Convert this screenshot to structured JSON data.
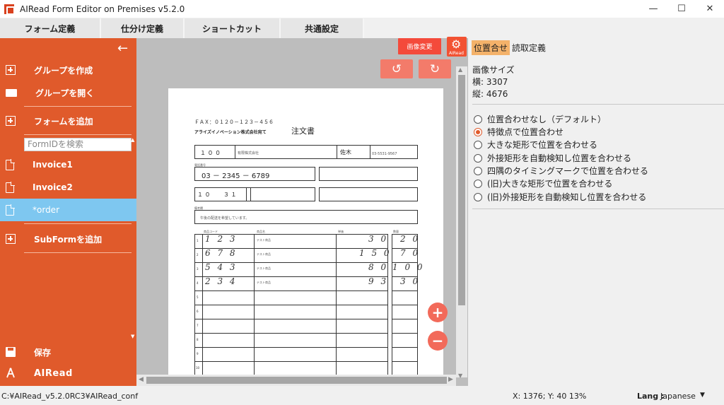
{
  "window": {
    "title": "AIRead Form Editor on Premises v5.2.0",
    "controls": {
      "minimize": "—",
      "maximize": "☐",
      "close": "✕"
    }
  },
  "menu": {
    "items": [
      "フォーム定義",
      "仕分け定義",
      "ショートカット",
      "共通設定"
    ]
  },
  "sidebar": {
    "back": "←",
    "create_group": "グループを作成",
    "open_group": "グループを開く",
    "add_form": "フォームを追加",
    "search_placeholder": "FormIDを検索",
    "forms": [
      "Invoice1",
      "Invoice2",
      "*order"
    ],
    "add_subform": "SubFormを追加",
    "save": "保存",
    "brand": "AIRead"
  },
  "canvas": {
    "image_change": "画像変更",
    "gear_label": "AIRead",
    "rotate_left": "↺",
    "rotate_right": "↻",
    "zoom_in": "+",
    "zoom_out": "−",
    "document": {
      "fax": "ＦＡＸ：０１２０－１２３－４５６",
      "to": "アライズイノベーション株式会社宛て",
      "title": "注文書",
      "row1_code": "１ ０ ０",
      "row1_company": "有限株式会社",
      "row1_name": "佐木",
      "row1_tel": "03-5531-9567",
      "phone_label": "電話番号",
      "phone": "03 － 2345 － 6789",
      "date_m": "１ ０",
      "date_d": "３ １",
      "note_label": "備考欄",
      "note_text": "午後の配送を希望しています。",
      "col_code": "商品コード",
      "col_name": "商品名",
      "col_price": "単価",
      "col_qty": "数量",
      "rows": [
        {
          "no": "1",
          "code": "1 2 3",
          "name": "テスト商品",
          "price": "3 0",
          "qty": "2 0"
        },
        {
          "no": "2",
          "code": "6 7 8",
          "name": "テスト商品",
          "price": "1 5 0",
          "qty": "7 0"
        },
        {
          "no": "3",
          "code": "5 4 3",
          "name": "テスト商品",
          "price": "8 0",
          "qty": "1 0 0"
        },
        {
          "no": "4",
          "code": "2 3 4",
          "name": "テスト商品",
          "price": "9 3",
          "qty": "3 0"
        }
      ],
      "empty_rows": [
        "5",
        "6",
        "7",
        "8",
        "9",
        "10"
      ]
    }
  },
  "right_panel": {
    "tabs": [
      "位置合せ",
      "読取定義"
    ],
    "image_size_label": "画像サイズ",
    "width_text": "横: 3307",
    "height_text": "縦: 4676",
    "options": [
      "位置合わせなし（デフォルト）",
      "特徴点で位置合わせ",
      "大きな矩形で位置を合わせる",
      "外接矩形を自動検知し位置を合わせる",
      "四隅のタイミングマークで位置を合わせる",
      "(旧)大きな矩形で位置を合わせる",
      "(旧)外接矩形を自動検知し位置を合わせる"
    ],
    "selected_option": 1
  },
  "status": {
    "path": "C:¥AIRead_v5.2.0RC3¥AIRead_conf",
    "coords": "X: 1376; Y: 40  13%",
    "lang_label": "Lang :",
    "lang": "Japanese",
    "lang_arrow": "▼"
  },
  "colors": {
    "sidebar": "#e05a2b",
    "active_item": "#7ec7f0",
    "accent_button": "#f44a3b",
    "tab_active": "#f4b26a"
  }
}
